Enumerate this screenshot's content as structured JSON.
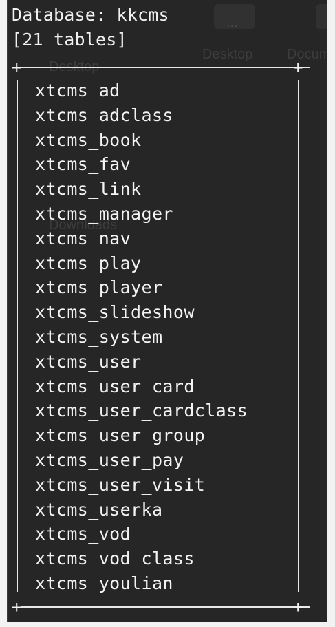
{
  "terminal": {
    "database_line": "Database: kkcms",
    "count_line": "[21 tables]",
    "border_corner": "+",
    "tables": [
      "xtcms_ad",
      "xtcms_adclass",
      "xtcms_book",
      "xtcms_fav",
      "xtcms_link",
      "xtcms_manager",
      "xtcms_nav",
      "xtcms_play",
      "xtcms_player",
      "xtcms_slideshow",
      "xtcms_system",
      "xtcms_user",
      "xtcms_user_card",
      "xtcms_user_cardclass",
      "xtcms_user_group",
      "xtcms_user_pay",
      "xtcms_user_visit",
      "xtcms_userka",
      "xtcms_vod",
      "xtcms_vod_class",
      "xtcms_youlian"
    ]
  },
  "background_window": {
    "ellipsis": "...",
    "desktop_label": "Desktop",
    "documents_label": "Docum",
    "sidebar_desktop": "Desktop",
    "sidebar_downloads": "Downloads"
  },
  "colors": {
    "terminal_bg": "#262626",
    "text": "#f1f1f1",
    "page_bg": "#f2f2f2"
  }
}
